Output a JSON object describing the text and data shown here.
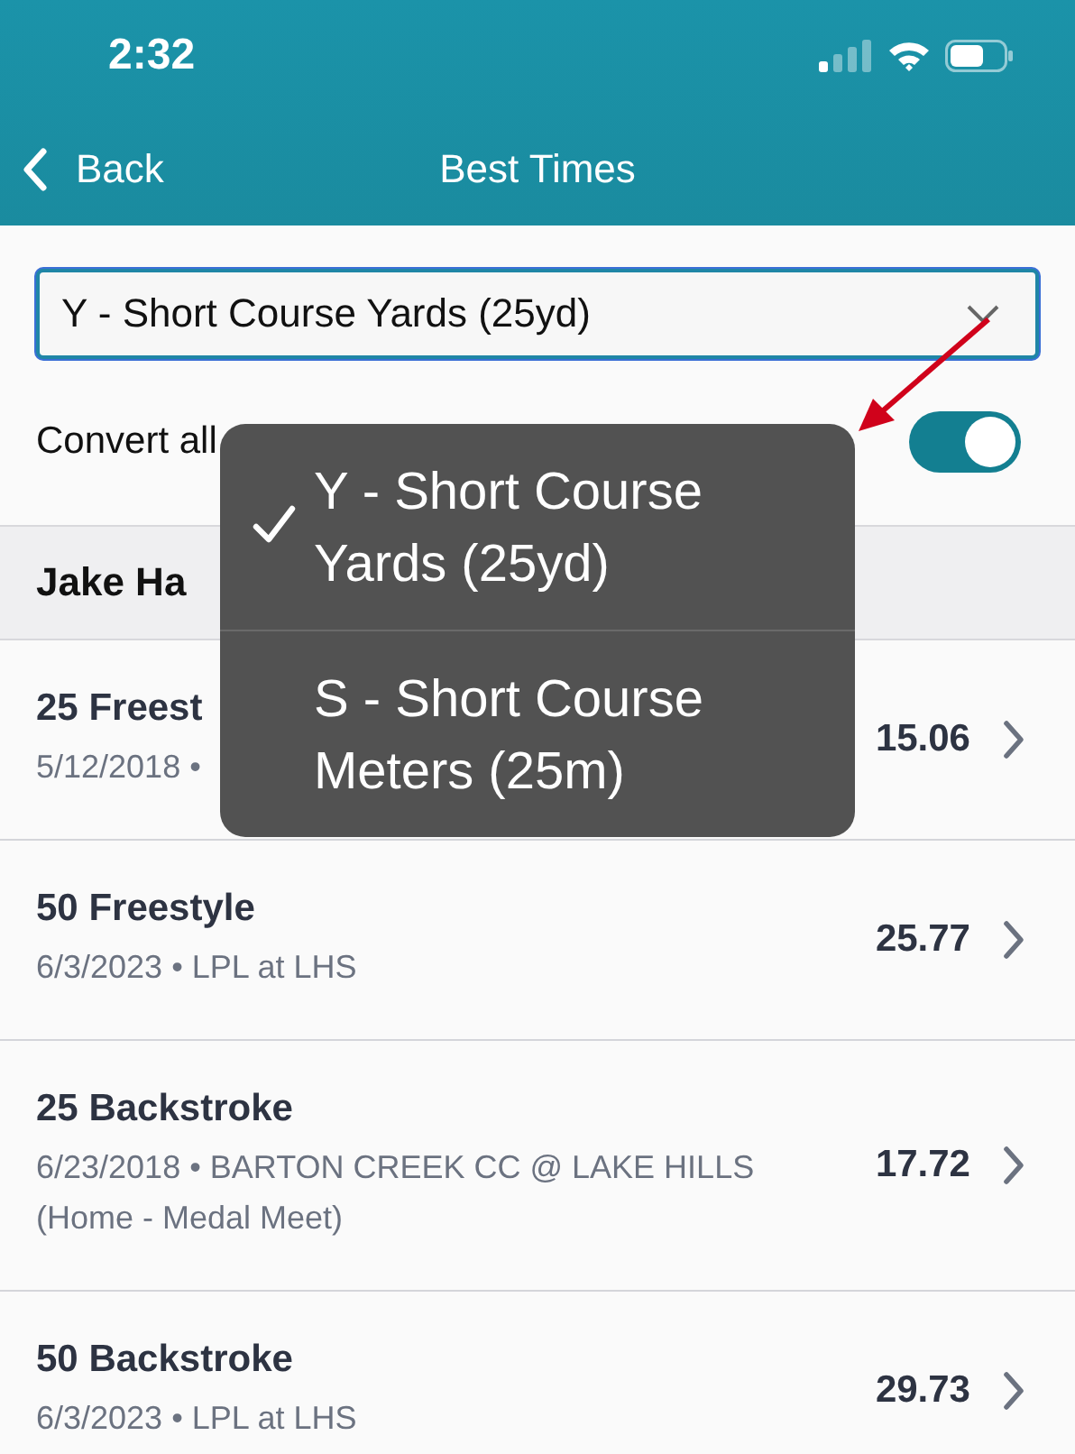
{
  "status_bar": {
    "time": "2:32"
  },
  "nav": {
    "back_label": "Back",
    "title": "Best Times"
  },
  "course_select": {
    "value": "Y - Short Course Yards (25yd)"
  },
  "convert": {
    "label": "Convert all",
    "on": true
  },
  "swimmer": {
    "name": "Jake Ha"
  },
  "rows": [
    {
      "event": "25 Freest",
      "details": "5/12/2018 •",
      "time": "15.06"
    },
    {
      "event": "50 Freestyle",
      "details": "6/3/2023 • LPL at LHS",
      "time": "25.77"
    },
    {
      "event": "25 Backstroke",
      "details": "6/23/2018 • BARTON CREEK CC @ LAKE HILLS (Home - Medal Meet)",
      "time": "17.72"
    },
    {
      "event": "50 Backstroke",
      "details": "6/3/2023 • LPL at LHS",
      "time": "29.73"
    }
  ],
  "dropdown": {
    "options": [
      {
        "label": "Y - Short Course Yards (25yd)",
        "selected": true
      },
      {
        "label": "S - Short Course Meters (25m)",
        "selected": false
      }
    ]
  }
}
